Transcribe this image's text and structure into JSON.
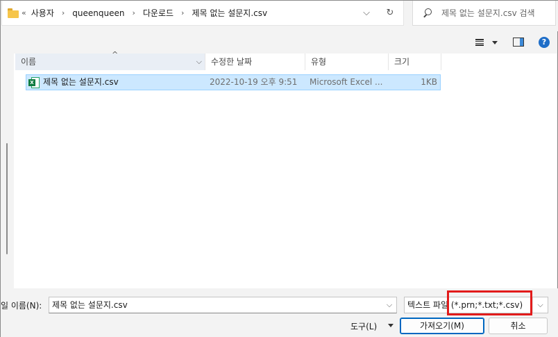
{
  "address": {
    "lead": "«",
    "crumbs": [
      "사용자",
      "queenqueen",
      "다운로드",
      "제목 없는 설문지.csv"
    ],
    "separator": "›",
    "dropdown_glyph": "⌵",
    "refresh_glyph": "↻"
  },
  "search": {
    "placeholder": "제목 없는 설문지.csv 검색"
  },
  "toolbar": {
    "help_glyph": "?"
  },
  "columns": {
    "name": "이름",
    "date": "수정한 날짜",
    "type": "유형",
    "size": "크기",
    "sort_glyph": "^",
    "chevron": "⌵"
  },
  "files": [
    {
      "name": "제목 없는 설문지.csv",
      "date": "2022-10-19 오후 9:51",
      "type": "Microsoft Excel ...",
      "size": "1KB",
      "icon": "excel-csv-icon",
      "icon_letter": "X"
    }
  ],
  "bottom": {
    "filename_label": "일 이름(N):",
    "filename_value": "제목 없는 설문지.csv",
    "filter_value": "텍스트 파일 (*.prn;*.txt;*.csv)",
    "tools_label": "도구(L)",
    "open_label": "가져오기(M)",
    "cancel_label": "취소",
    "drop_glyph": "⌵"
  },
  "colors": {
    "selection": "#cce8ff",
    "highlight_box": "#e21b1b",
    "accent": "#0067c0"
  }
}
